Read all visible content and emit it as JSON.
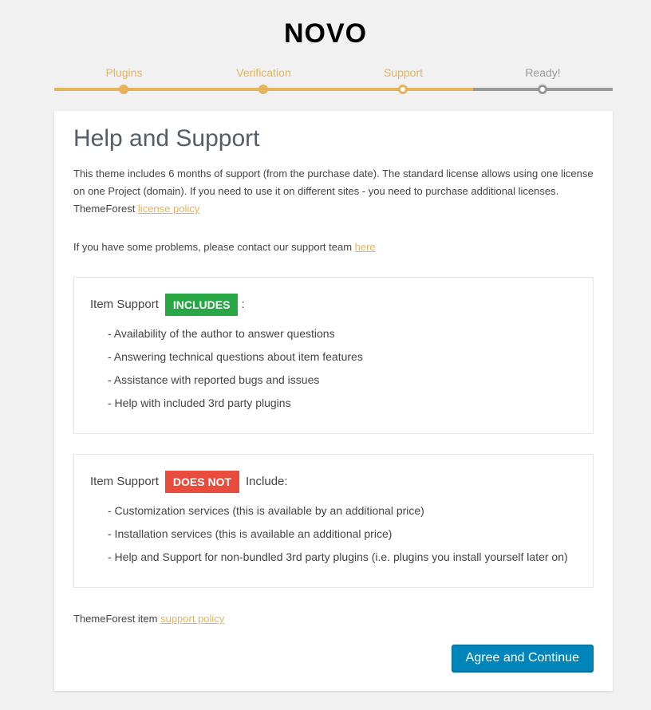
{
  "logo": "NOVO",
  "steps": [
    {
      "label": "Plugins",
      "state": "done"
    },
    {
      "label": "Verification",
      "state": "done"
    },
    {
      "label": "Support",
      "state": "current"
    },
    {
      "label": "Ready!",
      "state": "pending"
    }
  ],
  "colors": {
    "accent": "#e5b35a",
    "pending": "#999999",
    "includes_badge": "#28a745",
    "does_not_badge": "#e74c3c",
    "button": "#0085ba"
  },
  "card": {
    "title": "Help and Support",
    "intro_text": "This theme includes 6 months of support (from the purchase date). The standard license allows using one license on one Project (domain). If you need to use it on different sites - you need to purchase additional licenses. ThemeForest ",
    "intro_link": "license policy",
    "contact_text": "If you have some problems, please contact our support team ",
    "contact_link": "here",
    "includes": {
      "prefix": "Item Support",
      "badge": "INCLUDES",
      "suffix": ":",
      "items": [
        "- Availability of the author to answer questions",
        "- Answering technical questions about item features",
        "- Assistance with reported bugs and issues",
        "- Help with included 3rd party plugins"
      ]
    },
    "excludes": {
      "prefix": "Item Support",
      "badge": "DOES NOT",
      "suffix": "Include:",
      "items": [
        "- Customization services (this is available by an additional price)",
        "- Installation services (this is available an additional price)",
        "- Help and Support for non-bundled 3rd party plugins (i.e. plugins you install yourself later on)"
      ]
    },
    "policy_text": "ThemeForest item ",
    "policy_link": "support policy",
    "button_label": "Agree and Continue"
  }
}
